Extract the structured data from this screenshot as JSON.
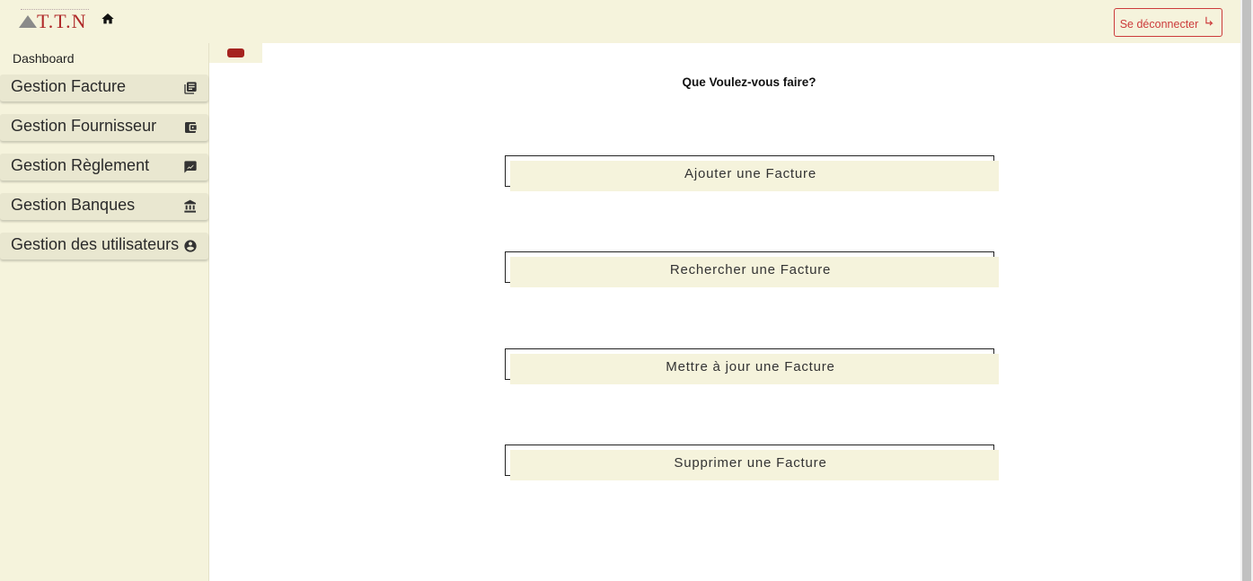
{
  "header": {
    "logo_text": "T.T.N",
    "logout_label": "Se déconnecter"
  },
  "sidebar": {
    "dashboard_label": "Dashboard",
    "items": [
      {
        "label": "Gestion Facture",
        "icon": "invoice-list-icon"
      },
      {
        "label": "Gestion Fournisseur",
        "icon": "wallet-icon"
      },
      {
        "label": "Gestion Règlement",
        "icon": "payment-chart-icon"
      },
      {
        "label": "Gestion Banques",
        "icon": "bank-icon"
      },
      {
        "label": "Gestion des utilisateurs",
        "icon": "user-circle-icon"
      }
    ]
  },
  "main": {
    "question": "Que Voulez-vous faire?",
    "actions": [
      "Ajouter une Facture",
      "Rechercher une Facture",
      "Mettre à jour une Facture",
      "Supprimer une Facture"
    ]
  },
  "colors": {
    "background": "#f5f3dc",
    "accent_red": "#cc3b3b",
    "pill_red": "#a5231f"
  }
}
